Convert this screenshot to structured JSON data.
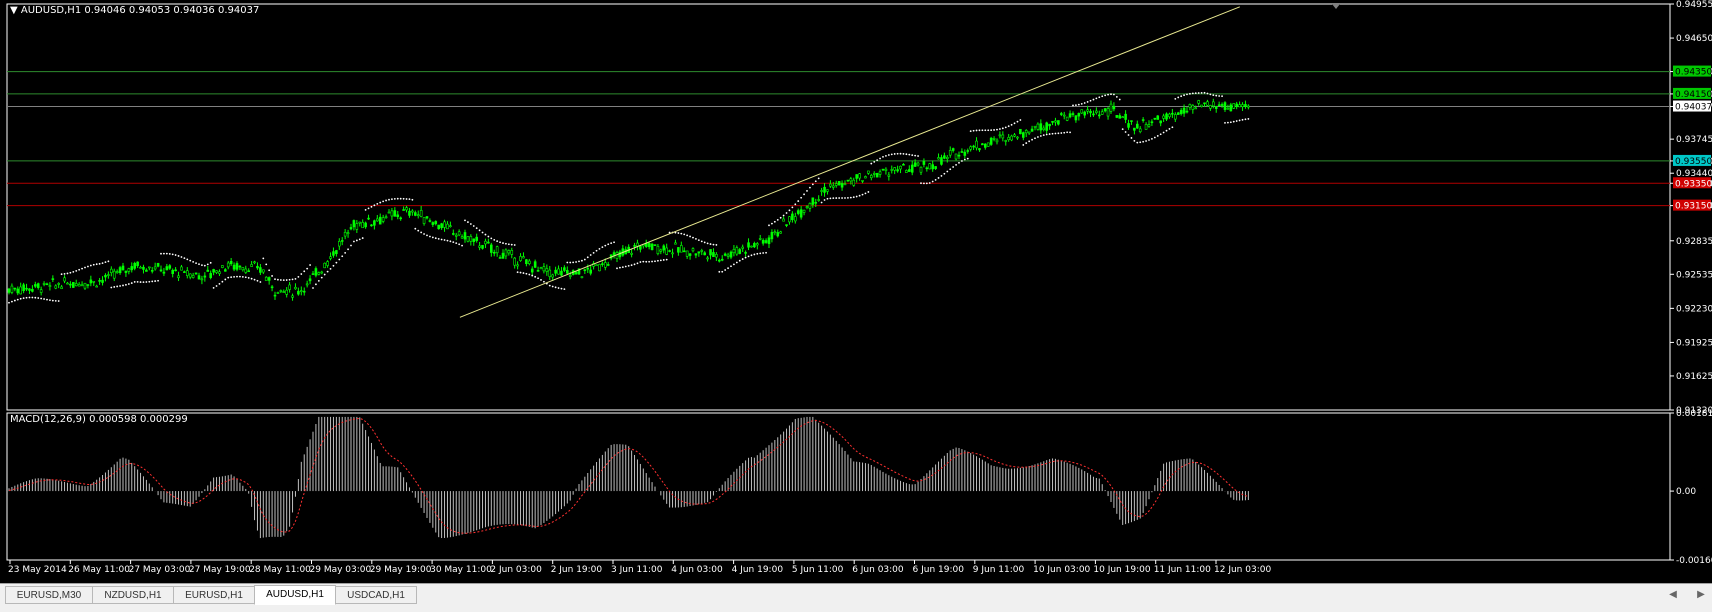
{
  "window": {
    "symbol_header": "AUDUSD,H1  0.94046 0.94053 0.94036 0.94037",
    "macd_header": "MACD(12,26,9) 0.000598 0.000299"
  },
  "chart_data": {
    "type": "candlestick",
    "symbol": "AUDUSD",
    "timeframe": "H1",
    "ohlc_current": {
      "open": 0.94046,
      "high": 0.94053,
      "low": 0.94036,
      "close": 0.94037
    },
    "price_axis_labels": [
      "0.94955",
      "0.94650",
      "0.94350",
      "0.94150",
      "0.94037",
      "0.93745",
      "0.93550",
      "0.93440",
      "0.93350",
      "0.93150",
      "0.92835",
      "0.92535",
      "0.92230",
      "0.91925",
      "0.91625",
      "0.91320"
    ],
    "time_axis_labels": [
      "23 May 2014",
      "26 May 11:00",
      "27 May 03:00",
      "27 May 19:00",
      "28 May 11:00",
      "29 May 03:00",
      "29 May 19:00",
      "30 May 11:00",
      "2 Jun 03:00",
      "2 Jun 19:00",
      "3 Jun 11:00",
      "4 Jun 03:00",
      "4 Jun 19:00",
      "5 Jun 11:00",
      "6 Jun 03:00",
      "6 Jun 19:00",
      "9 Jun 11:00",
      "10 Jun 03:00",
      "10 Jun 19:00",
      "11 Jun 11:00",
      "12 Jun 03:00"
    ],
    "price_range": [
      0.9132,
      0.94955
    ],
    "horizontal_levels": [
      {
        "price": 0.9435,
        "color": "#2e8b2e",
        "label_bg": "#00c800"
      },
      {
        "price": 0.9415,
        "color": "#2e8b2e",
        "label_bg": "#00c800"
      },
      {
        "price": 0.9355,
        "color": "#2e8b2e",
        "label_bg": "#00c8c8"
      },
      {
        "price": 0.9335,
        "color": "#b00000",
        "label_bg": "#d00000"
      },
      {
        "price": 0.9315,
        "color": "#b00000",
        "label_bg": "#d00000"
      }
    ],
    "bid_line": {
      "price": 0.94037,
      "color": "#808080",
      "label_bg": "#ffffff"
    },
    "trendlines": [
      {
        "from": {
          "bar": 196,
          "price": 0.9215
        },
        "to": {
          "bar": 535,
          "price": 0.9493
        },
        "color": "#e8e890"
      },
      {
        "from": {
          "bar": 0,
          "price": 0.9221
        },
        "to": {
          "bar": 280,
          "price": 0.9243
        },
        "color": "#ffffff",
        "style": "dotted"
      }
    ],
    "bar_count": 425,
    "macd": {
      "params": "12,26,9",
      "main": 0.000598,
      "signal": 0.000299,
      "range": [
        -0.0016,
        0.001813
      ],
      "axis_labels": [
        "0.001813",
        "0.00",
        "-0.00160"
      ]
    },
    "colors": {
      "background": "#000000",
      "candle": "#00ff00",
      "grid": "#ffffff",
      "macd_hist": "#c0c0c0",
      "macd_signal": "#ff3030",
      "sar": "#ffffff",
      "axis_text": "#ffffff"
    }
  },
  "tabs": [
    {
      "label": "EURUSD,M30",
      "active": false
    },
    {
      "label": "NZDUSD,H1",
      "active": false
    },
    {
      "label": "EURUSD,H1",
      "active": false
    },
    {
      "label": "AUDUSD,H1",
      "active": true
    },
    {
      "label": "USDCAD,H1",
      "active": false
    }
  ]
}
